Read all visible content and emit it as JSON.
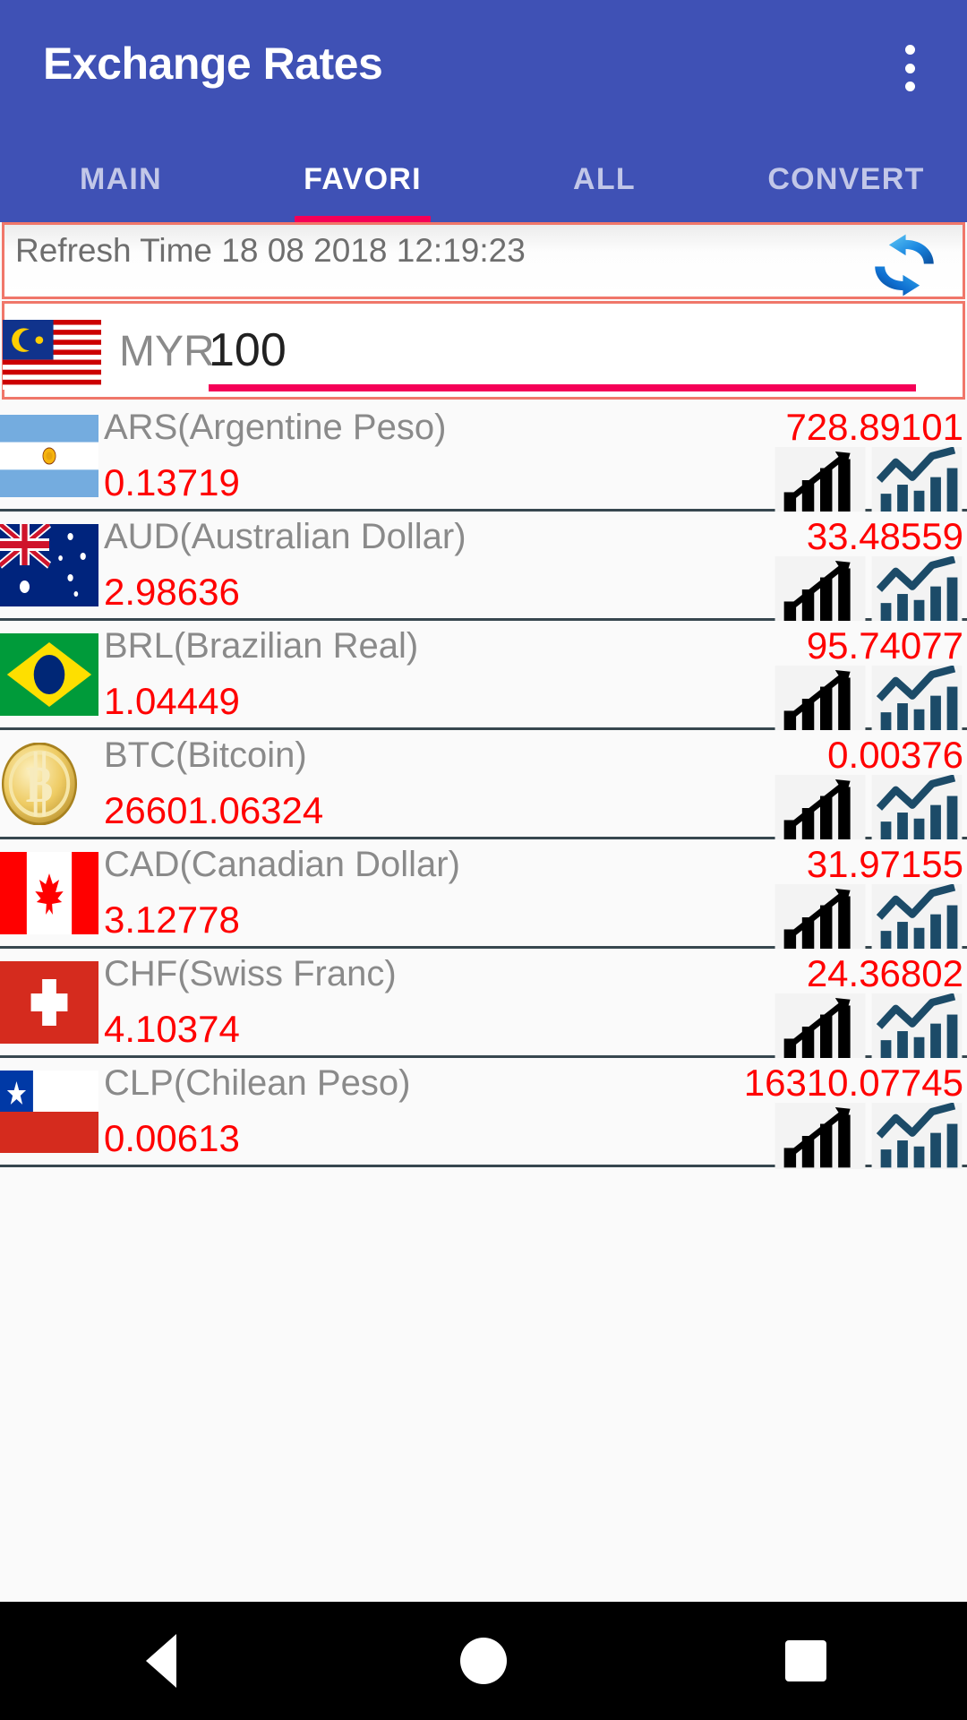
{
  "app": {
    "title": "Exchange Rates",
    "overflow_menu": "⋮"
  },
  "tabs": [
    {
      "label": "MAIN",
      "active": false
    },
    {
      "label": "FAVORI",
      "active": true
    },
    {
      "label": "ALL",
      "active": false
    },
    {
      "label": "CONVERT",
      "active": false
    }
  ],
  "refresh": {
    "label": "Refresh Time 18 08 2018 12:19:23",
    "icon": "refresh-icon"
  },
  "base_currency": {
    "code": "MYR",
    "amount": "100",
    "flag": "malaysia-flag"
  },
  "colors": {
    "appbar": "#3f51b5",
    "tab_indicator": "#f50057",
    "value_red": "#ff0000",
    "label_gray": "#8a8a8a",
    "row_divider": "#37474f",
    "frame_outline": "#f0776a"
  },
  "currencies": [
    {
      "code": "ARS",
      "name": "ARS(Argentine Peso)",
      "converted": "728.89101",
      "rate": "0.13719",
      "flag": "argentina-flag"
    },
    {
      "code": "AUD",
      "name": "AUD(Australian Dollar)",
      "converted": "33.48559",
      "rate": "2.98636",
      "flag": "australia-flag"
    },
    {
      "code": "BRL",
      "name": "BRL(Brazilian Real)",
      "converted": "95.74077",
      "rate": "1.04449",
      "flag": "brazil-flag"
    },
    {
      "code": "BTC",
      "name": "BTC(Bitcoin)",
      "converted": "0.00376",
      "rate": "26601.06324",
      "flag": "bitcoin-coin"
    },
    {
      "code": "CAD",
      "name": "CAD(Canadian Dollar)",
      "converted": "31.97155",
      "rate": "3.12778",
      "flag": "canada-flag"
    },
    {
      "code": "CHF",
      "name": "CHF(Swiss Franc)",
      "converted": "24.36802",
      "rate": "4.10374",
      "flag": "switzerland-flag"
    },
    {
      "code": "CLP",
      "name": "CLP(Chilean Peso)",
      "converted": "16310.07745",
      "rate": "0.00613",
      "flag": "chile-flag"
    }
  ],
  "navbar": {
    "back": "back-button",
    "home": "home-button",
    "recents": "recents-button"
  }
}
